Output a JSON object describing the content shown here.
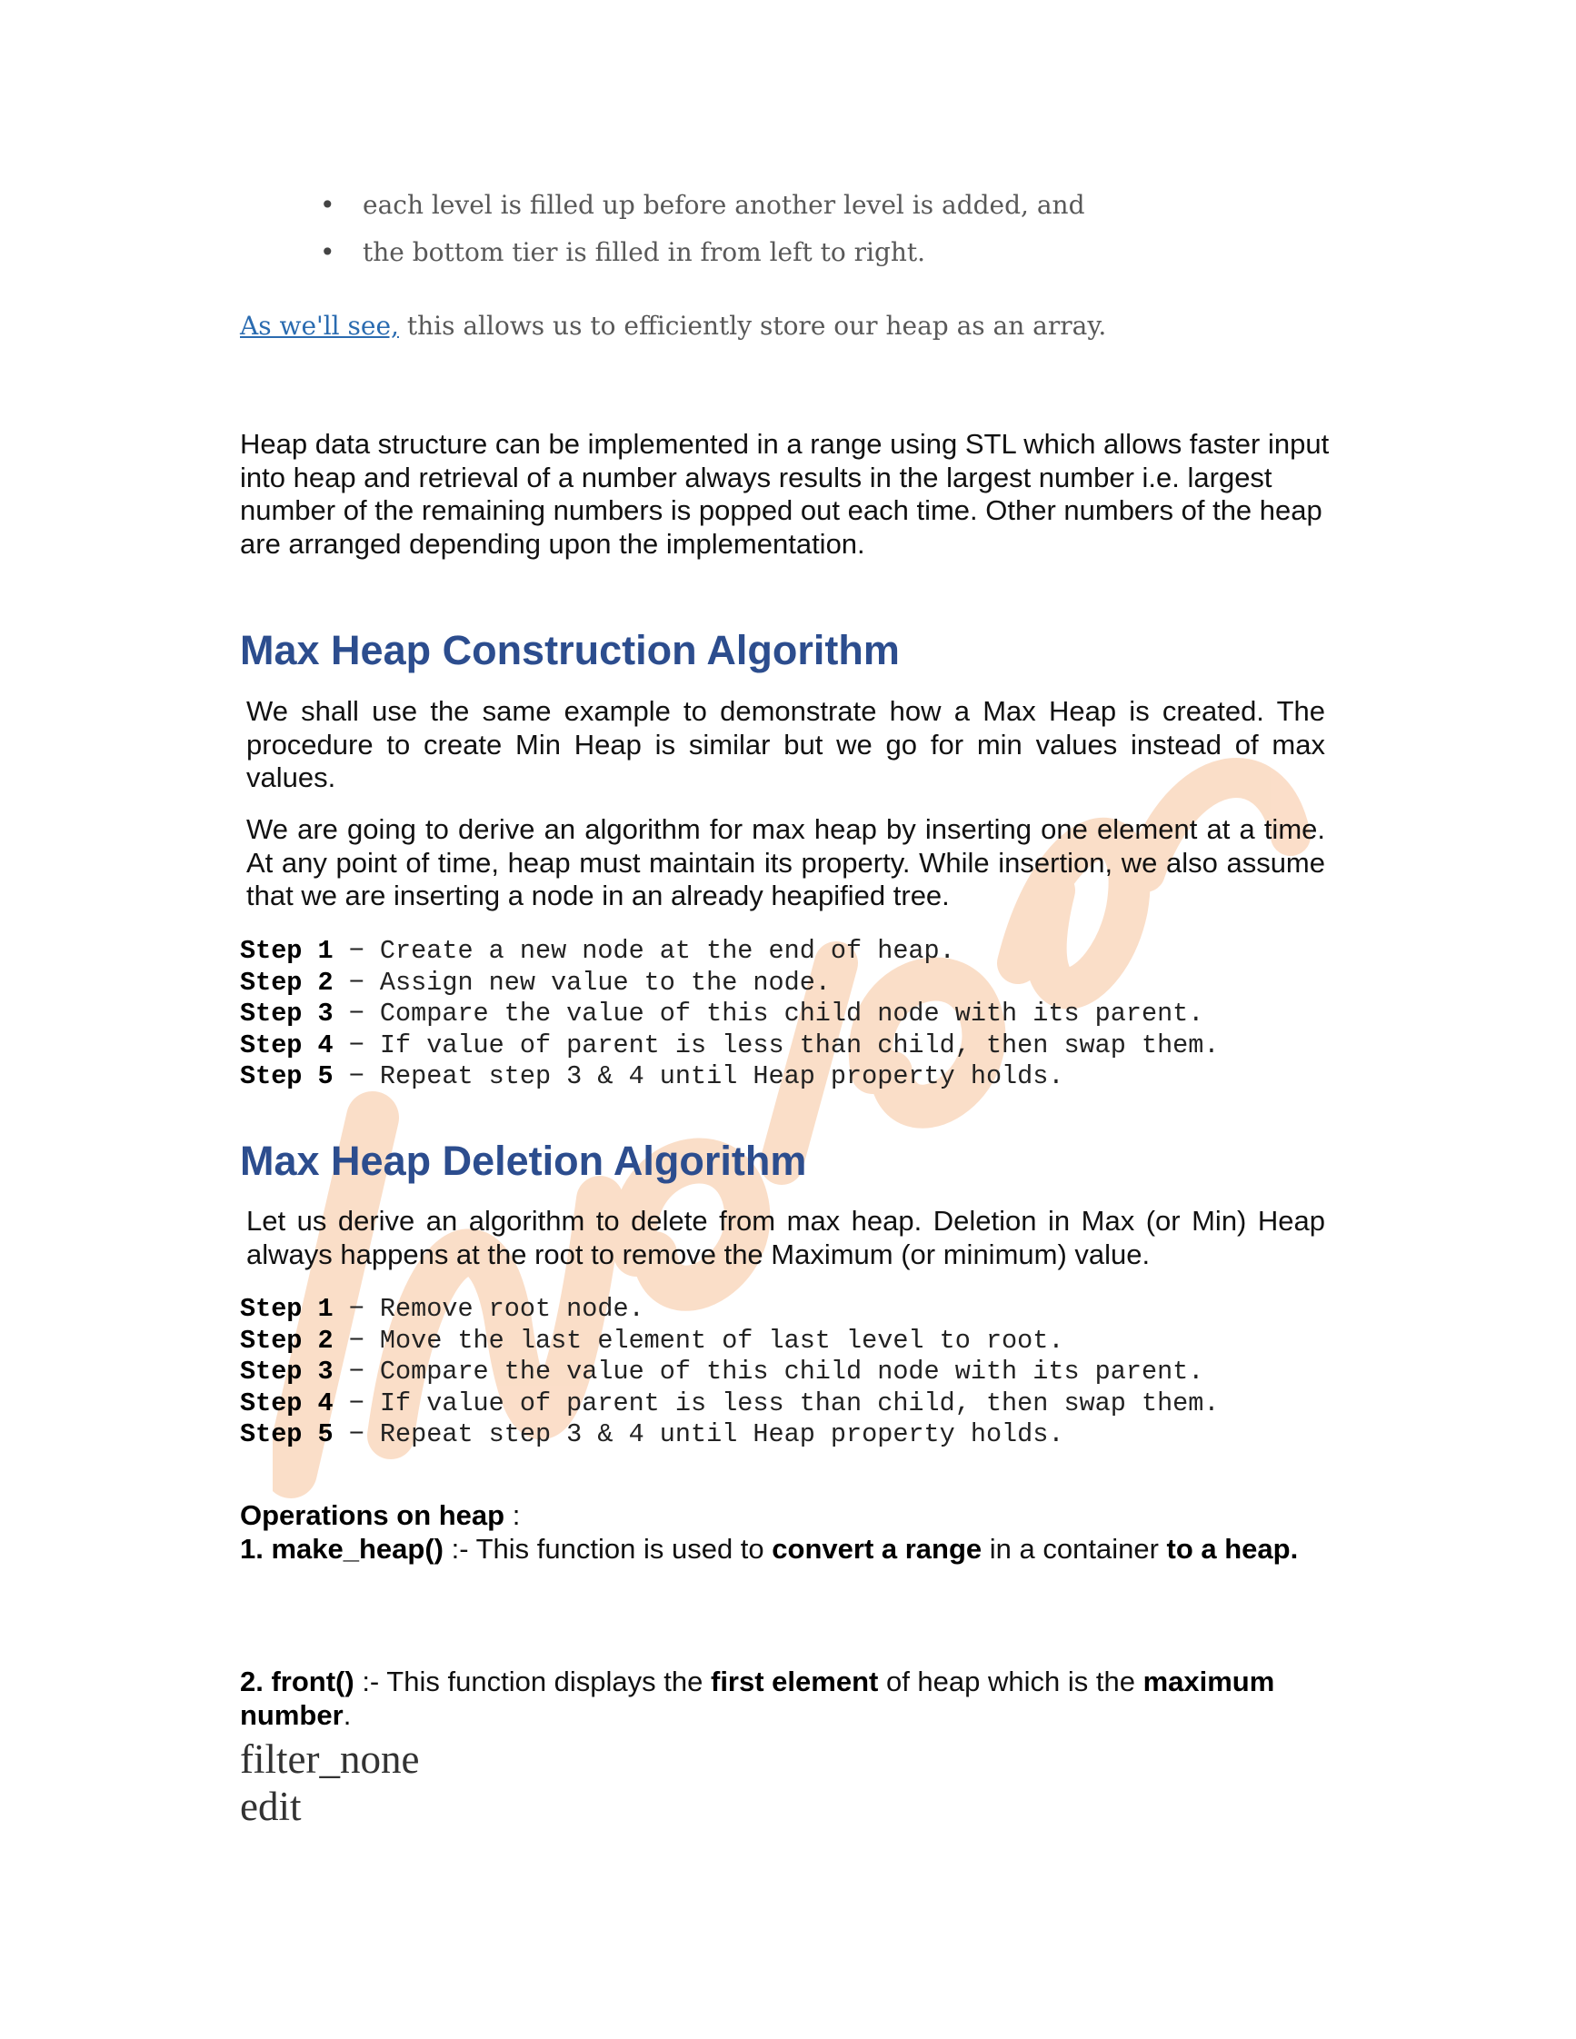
{
  "bullets": [
    "each level is filled up before another level is added, and",
    "the bottom tier is filled in from left to right."
  ],
  "array_note": {
    "link_text": "As we'll see,",
    "text": " this allows us to efficiently store our heap as an array."
  },
  "intro_paragraph": "Heap data structure can be implemented in a range using STL which allows faster input into heap and retrieval of a number always results in the largest number i.e. largest number of the remaining numbers is popped out each time. Other numbers of the heap are arranged depending upon the implementation.",
  "construction": {
    "heading": "Max Heap Construction Algorithm",
    "para1": "We shall use the same example to demonstrate how a Max Heap is created. The procedure to create Min Heap is similar but we go for min values instead of max values.",
    "para2": "We are going to derive an algorithm for max heap by inserting one element at a time. At any point of time, heap must maintain its property. While insertion, we also assume that we are inserting a node in an already heapified tree.",
    "steps": [
      {
        "label": "Step 1",
        "text": " − Create a new node at the end of heap."
      },
      {
        "label": "Step 2",
        "text": " − Assign new value to the node."
      },
      {
        "label": "Step 3",
        "text": " − Compare the value of this child node with its parent."
      },
      {
        "label": "Step 4",
        "text": " − If value of parent is less than child, then swap them."
      },
      {
        "label": "Step 5",
        "text": " − Repeat step 3 & 4 until Heap property holds."
      }
    ]
  },
  "deletion": {
    "heading": "Max Heap Deletion Algorithm",
    "para1": "Let us derive an algorithm to delete from max heap. Deletion in Max (or Min) Heap always happens at the root to remove the Maximum (or minimum) value.",
    "steps": [
      {
        "label": "Step 1",
        "text": " − Remove root node."
      },
      {
        "label": "Step 2",
        "text": " − Move the last element of last level to root."
      },
      {
        "label": "Step 3",
        "text": " − Compare the value of this child node with its parent."
      },
      {
        "label": "Step 4",
        "text": " − If value of parent is less than child, then swap them."
      },
      {
        "label": "Step 5",
        "text": " − Repeat step 3 & 4 until Heap property holds."
      }
    ]
  },
  "operations": {
    "title": "Operations on heap",
    "title_suffix": " :",
    "op1": {
      "name": "1. make_heap()",
      "t1": " :- This function is used to ",
      "b1": "convert a range",
      "t2": " in a container ",
      "b2": "to a heap."
    },
    "op2": {
      "name": "2. front()",
      "t1": " :- This function displays the ",
      "b1": "first element",
      "t2": " of heap which is the ",
      "b2": "maximum number",
      "t3": "."
    }
  },
  "tail_lines": [
    "filter_none",
    "edit"
  ],
  "watermark_text": "lovesnotes",
  "colors": {
    "heading": "#2c4d8e",
    "link": "#2a6bb0",
    "watermark": "#f4a460"
  }
}
